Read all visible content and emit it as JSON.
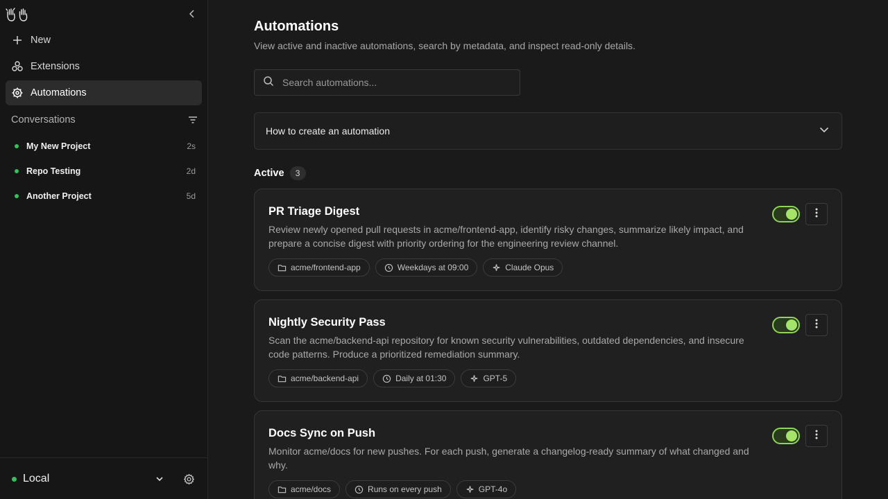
{
  "sidebar": {
    "logo_icon": "waving-hands-icon",
    "nav": [
      {
        "label": "New",
        "icon": "plus-icon"
      },
      {
        "label": "Extensions",
        "icon": "extensions-icon"
      },
      {
        "label": "Automations",
        "icon": "automations-gear-icon",
        "active": true
      }
    ],
    "conversations_title": "Conversations",
    "conversations": [
      {
        "name": "My New Project",
        "time": "2s"
      },
      {
        "name": "Repo Testing",
        "time": "2d"
      },
      {
        "name": "Another Project",
        "time": "5d"
      }
    ],
    "environment": {
      "label": "Local",
      "status_color": "#33c15b"
    }
  },
  "main": {
    "title": "Automations",
    "subtitle": "View active and inactive automations, search by metadata, and inspect read-only details.",
    "search_placeholder": "Search automations...",
    "accordion_label": "How to create an automation",
    "section_title": "Active",
    "section_count": "3",
    "automations": [
      {
        "title": "PR Triage Digest",
        "description": "Review newly opened pull requests in acme/frontend-app, identify risky changes, summarize likely impact, and prepare a concise digest with priority ordering for the engineering review channel.",
        "repo": "acme/frontend-app",
        "schedule": "Weekdays at 09:00",
        "model": "Claude Opus",
        "enabled": true
      },
      {
        "title": "Nightly Security Pass",
        "description": "Scan the acme/backend-api repository for known security vulnerabilities, outdated dependencies, and insecure code patterns. Produce a prioritized remediation summary.",
        "repo": "acme/backend-api",
        "schedule": "Daily at 01:30",
        "model": "GPT-5",
        "enabled": true
      },
      {
        "title": "Docs Sync on Push",
        "description": "Monitor acme/docs for new pushes. For each push, generate a changelog-ready summary of what changed and why.",
        "repo": "acme/docs",
        "schedule": "Runs on every push",
        "model": "GPT-4o",
        "enabled": true
      }
    ]
  },
  "colors": {
    "accent_green": "#a4e46a",
    "status_green": "#33c15b",
    "background": "#1a1a1a",
    "sidebar": "#161616"
  }
}
